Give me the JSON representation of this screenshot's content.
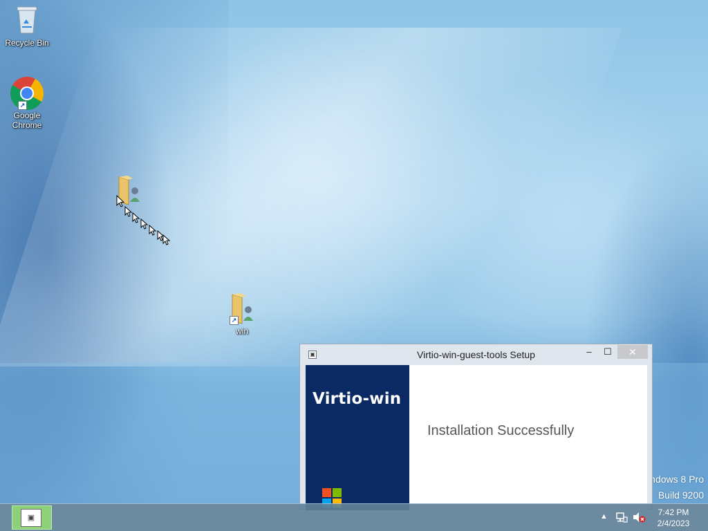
{
  "desktop": {
    "icons": [
      {
        "label": "Recycle Bin"
      },
      {
        "label": "Google Chrome"
      },
      {
        "label": ""
      },
      {
        "label": "win"
      }
    ],
    "watermark": {
      "line1": "ndows 8 Pro",
      "line2": "Build 9200"
    }
  },
  "dialog": {
    "title": "Virtio-win-guest-tools Setup",
    "minimize_label": "–",
    "maximize_label": "☐",
    "close_label": "✕",
    "brand": "Virtio-win",
    "message": "Installation Successfully"
  },
  "taskbar": {
    "tray_arrow": "▲",
    "clock_time": "7:42 PM",
    "clock_date": "2/4/2023"
  },
  "colors": {
    "sidebar": "#0b2a63",
    "close_button": "#c7c9cc",
    "taskbar": "#5f8098",
    "taskbar_active_app": "#8fd07a",
    "volume_mute": "#e02020"
  }
}
